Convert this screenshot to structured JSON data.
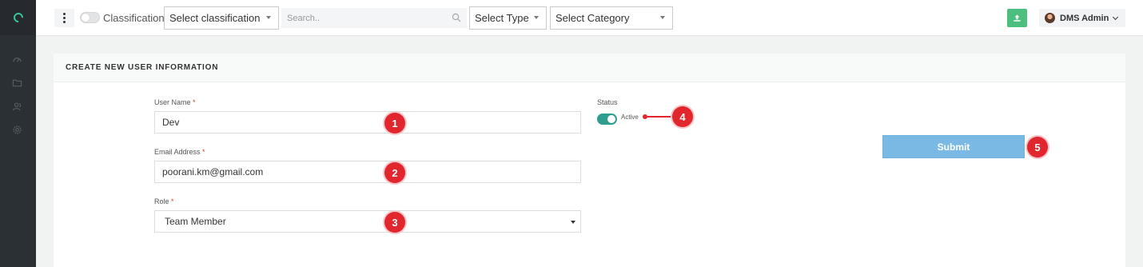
{
  "topbar": {
    "classification_label": "Classification",
    "classification_select": "Select classification",
    "search_placeholder": "Search..",
    "type_select": "Select Type",
    "category_select": "Select Category",
    "user_name": "DMS Admin"
  },
  "panel": {
    "title": "CREATE NEW USER INFORMATION"
  },
  "form": {
    "username_label": "User Name",
    "username_value": "Dev",
    "email_label": "Email Address",
    "email_value": "poorani.km@gmail.com",
    "role_label": "Role",
    "role_value": "Team Member",
    "required_mark": "*",
    "status_label": "Status",
    "status_value": "Active",
    "status_on": true,
    "submit_label": "Submit"
  },
  "callouts": [
    "1",
    "2",
    "3",
    "4",
    "5"
  ],
  "colors": {
    "sidebar": "#2b3034",
    "accent_teal": "#2f9e8f",
    "submit": "#7ab9e3",
    "upload": "#4cbf7e",
    "callout": "#e1262d"
  },
  "icons": {
    "sidebar": [
      "dashboard-icon",
      "folder-icon",
      "users-icon",
      "settings-icon"
    ],
    "toolbar": [
      "kebab-menu-icon",
      "search-icon",
      "upload-icon",
      "chevron-down-icon"
    ]
  }
}
